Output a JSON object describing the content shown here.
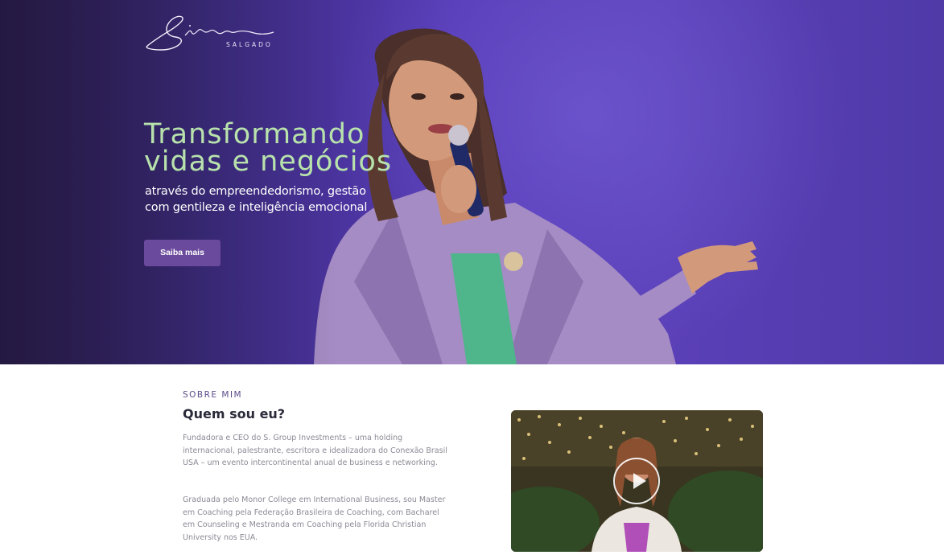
{
  "brand": {
    "name_script": "Simone",
    "name_sub": "SALGADO"
  },
  "hero": {
    "title_line1": "Transformando",
    "title_line2": "vidas e negócios",
    "subtitle": "através do empreendedorismo, gestão com gentileza e inteligência emocional",
    "cta_label": "Saiba mais"
  },
  "about": {
    "eyebrow": "SOBRE MIM",
    "title": "Quem sou eu?",
    "paragraph1": "Fundadora e CEO do S. Group Investments – uma holding internacional, palestrante, escritora e idealizadora do Conexão Brasil USA – um evento intercontinental anual de business e networking.",
    "paragraph2": "Graduada pelo Monor College em International Business, sou Master em Coaching pela Federação Brasileira de Coaching, com Bacharel em Counseling e Mestranda em Coaching pela Florida Christian University nos EUA."
  },
  "colors": {
    "hero_bg": "#5539b4",
    "title_green": "#b8e2ac",
    "button": "#6a4a9c",
    "eyebrow": "#5a4a8c"
  },
  "icons": {
    "video_play": "play-icon"
  }
}
